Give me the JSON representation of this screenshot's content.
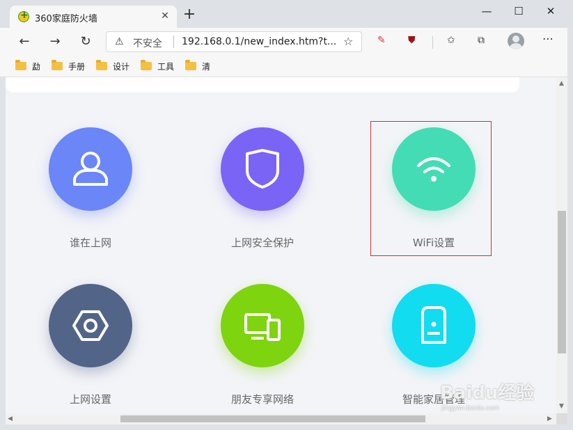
{
  "browser": {
    "tab_title": "360家庭防火墙",
    "tab_close": "✕",
    "new_tab": "+",
    "window_controls": {
      "minimize": "—",
      "maximize": "☐",
      "close": "✕"
    },
    "security_label": "不安全",
    "url": "192.168.0.1/new_index.htm?t...",
    "bookmarks": [
      {
        "label": "勐"
      },
      {
        "label": "手册"
      },
      {
        "label": "设计"
      },
      {
        "label": "工具"
      },
      {
        "label": "清"
      }
    ]
  },
  "tiles": [
    {
      "label": "谁在上网",
      "color": "#6b86f7",
      "icon": "user-icon"
    },
    {
      "label": "上网安全保护",
      "color": "#7a64f6",
      "icon": "shield-icon"
    },
    {
      "label": "WiFi设置",
      "color": "#44dcb4",
      "icon": "wifi-icon",
      "highlighted": true
    },
    {
      "label": "上网设置",
      "color": "#536489",
      "icon": "hex-nut-icon"
    },
    {
      "label": "朋友专享网络",
      "color": "#7ed40f",
      "icon": "devices-icon"
    },
    {
      "label": "智能家居管理",
      "color": "#12dcef",
      "icon": "smart-device-icon"
    }
  ],
  "watermark": {
    "text": "Baidu经验",
    "sub": "jingyan.baidu.com"
  }
}
